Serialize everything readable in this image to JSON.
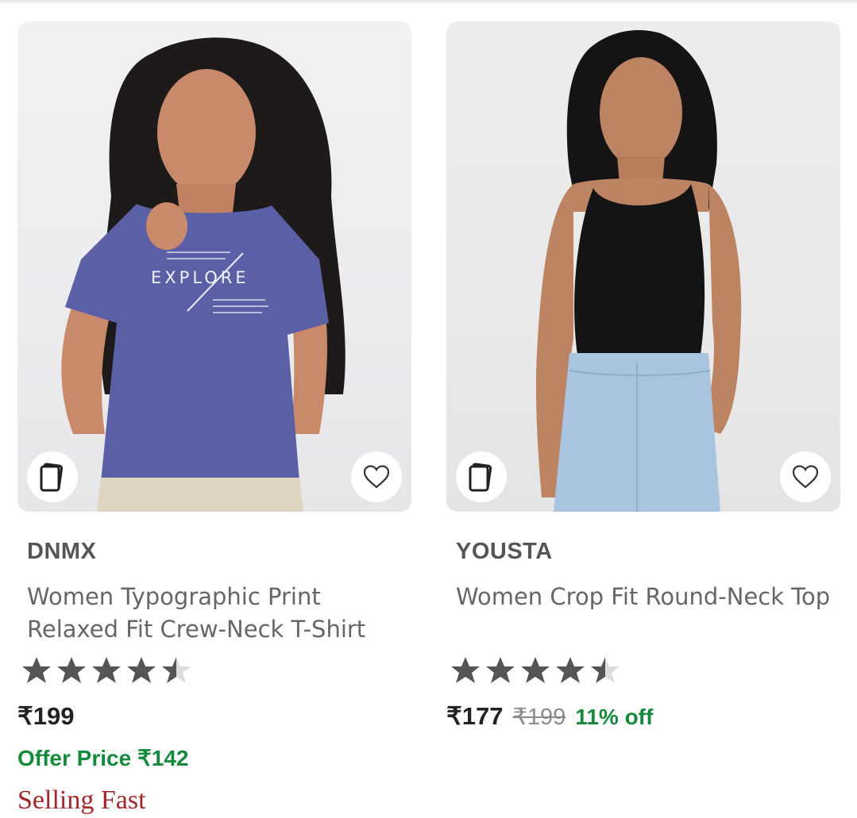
{
  "products": [
    {
      "brand": "DNMX",
      "name": "Women Typographic Print Relaxed Fit Crew-Neck T-Shirt",
      "rating": 4.5,
      "price": "₹199",
      "offer_price": "Offer Price ₹142",
      "badge": "Selling Fast",
      "print_text": "EXPLORE",
      "icons": {
        "similar": "cards-icon",
        "wishlist": "heart-icon"
      }
    },
    {
      "brand": "YOUSTA",
      "name": "Women Crop Fit Round-Neck Top",
      "rating": 4.5,
      "price": "₹177",
      "mrp": "₹199",
      "discount": "11% off",
      "icons": {
        "similar": "cards-icon",
        "wishlist": "heart-icon"
      }
    }
  ],
  "colors": {
    "discount_green": "#168a3c",
    "selling_fast_red": "#a5272a",
    "star_gray": "#555555",
    "tee_blue": "#5a5fa6"
  }
}
